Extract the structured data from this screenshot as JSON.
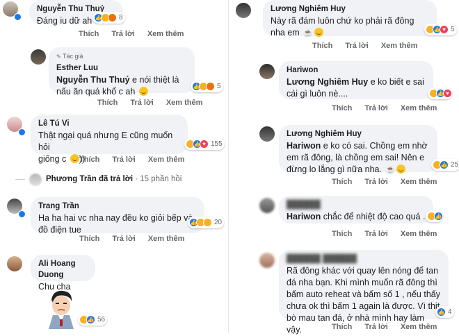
{
  "labels": {
    "like": "Thích",
    "reply": "Trả lời",
    "more": "Xem thêm",
    "author_tag": "Tác giả",
    "replied": "đã trả lời",
    "reply_time": "· 15 phần hồi"
  },
  "left": {
    "c1": {
      "name": "Nguyễn Thu Thuỷ",
      "text": "Đáng iu dữ ah",
      "count": "8"
    },
    "c2": {
      "name": "Esther Luu",
      "mention": "Nguyễn Thu Thuỷ",
      "text": " e nói thiệt là nấu ăn quá khổ c ah",
      "count": "5"
    },
    "c3": {
      "name": "Lê Tú Vi",
      "line1": "Thật ngại quá nhưng E cũng muốn hỏi",
      "line2": "giống c",
      "line2_end": "))",
      "count": "155"
    },
    "c4": {
      "name": "Phương Trần"
    },
    "c5": {
      "name": "Trang Trần",
      "line1": "Ha ha hai vc nha nay đều ko giỏi bếp và",
      "line2": "đồ điện tue",
      "count": "20"
    },
    "c6": {
      "name": "Ali Hoang Duong",
      "text": "Chu cha",
      "count": "56"
    }
  },
  "right": {
    "c1": {
      "name": "Lương Nghiêm Huy",
      "line1": "Này rã đám luôn chứ ko phải rã đông",
      "line2": "nha em",
      "count": "5"
    },
    "c2": {
      "name": "Hariwon",
      "mention": "Lương Nghiêm Huy",
      "text1": " e ko biết e sai",
      "line2": "cái gì luôn nè....",
      "count": ""
    },
    "c3": {
      "name": "Lương Nghiêm Huy",
      "mention": "Hariwon",
      "line1": " e ko có sai. Chồng em nhờ",
      "line2": "em rã đông, là chồng em sai! Nên e",
      "line3": "đừng lo lắng gì nữa nha.",
      "count": "25"
    },
    "c4": {
      "name": "██████",
      "mention": "Hariwon",
      "text": " chắc để nhiệt độ cao quá .",
      "count": ""
    },
    "c5": {
      "name": "██████ ██████",
      "lines": [
        "Rã đông khác với quay lên nóng để tan",
        "đá nha bạn. Khi mình muốn rã đông thì",
        "bấm auto reheat và bấm số 1 , nếu thấy",
        "chưa ok thì bấm 1 again là được. Vì thịt",
        "bò mau tan đá, ở nhà mình hay làm vậy."
      ],
      "count": "4"
    }
  },
  "colors": {
    "bubble": "#f0f2f5",
    "meta": "#65676b",
    "like": "#1877f2",
    "haha": "#f7b125"
  }
}
